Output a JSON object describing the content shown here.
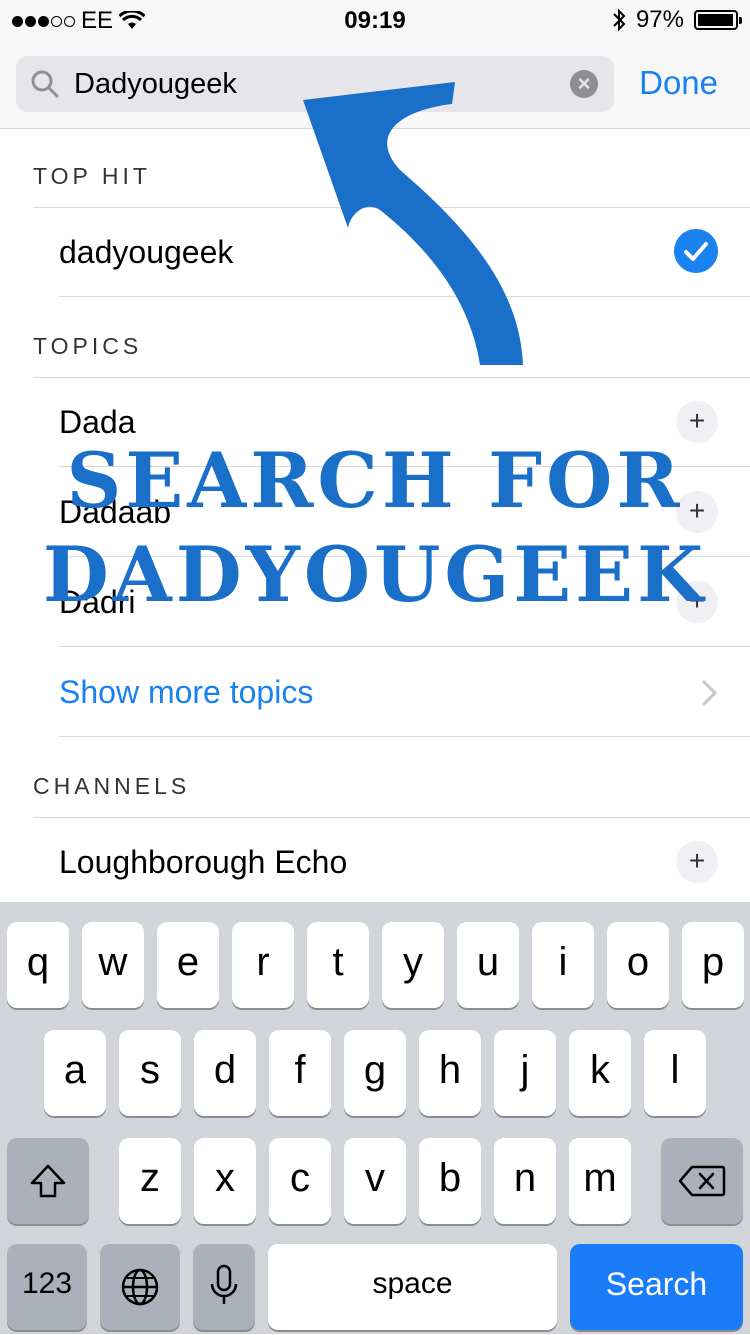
{
  "status_bar": {
    "carrier": "EE",
    "time": "09:19",
    "battery": "97%",
    "battery_level": 0.97
  },
  "search": {
    "value": "Dadyougeek",
    "done_label": "Done"
  },
  "top_hit": {
    "header": "TOP HIT",
    "item": "dadyougeek"
  },
  "topics": {
    "header": "TOPICS",
    "items": [
      "Dada",
      "Dadaab",
      "Dadri"
    ],
    "show_more": "Show more topics"
  },
  "channels": {
    "header": "CHANNELS",
    "items": [
      "Loughborough Echo"
    ]
  },
  "overlay": {
    "line1": "SEARCH FOR",
    "line2": "DADYOUGEEK"
  },
  "keyboard": {
    "row1": [
      "q",
      "w",
      "e",
      "r",
      "t",
      "y",
      "u",
      "i",
      "o",
      "p"
    ],
    "row2": [
      "a",
      "s",
      "d",
      "f",
      "g",
      "h",
      "j",
      "k",
      "l"
    ],
    "row3": [
      "z",
      "x",
      "c",
      "v",
      "b",
      "n",
      "m"
    ],
    "numbers_label": "123",
    "space_label": "space",
    "search_label": "Search"
  },
  "colors": {
    "accent": "#1a82f0",
    "overlay": "#1a6fc9"
  }
}
